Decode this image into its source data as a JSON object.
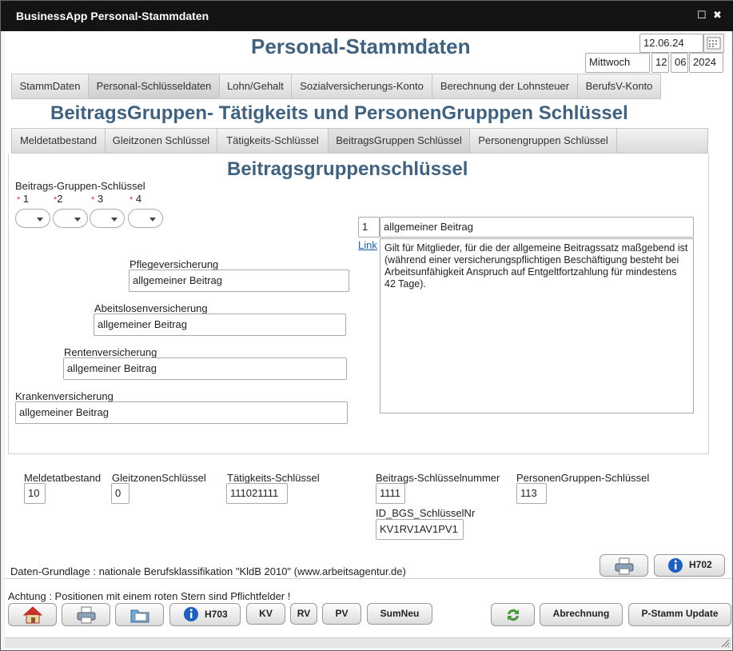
{
  "window": {
    "title": "BusinessApp Personal-Stammdaten",
    "restore_label": "☐",
    "close_label": "✖"
  },
  "header": {
    "title": "Personal-Stammdaten",
    "date": "12.06.24",
    "weekday": "Mittwoch",
    "day": "12",
    "month": "06",
    "year": "2024"
  },
  "main_tabs": [
    "StammDaten",
    "Personal-Schlüsseldaten",
    "Lohn/Gehalt",
    "Sozialversicherungs-Konto",
    "Berechnung der Lohnsteuer",
    "BerufsV-Konto"
  ],
  "section_title": "BeitragsGruppen- Tätigkeits und PersonenGrupppen Schlüssel",
  "sub_tabs": [
    "Meldetatbestand",
    "Gleitzonen Schlüssel",
    "Tätigkeits-Schlüssel",
    "BeitragsGruppen Schlüssel",
    "Personengruppen Schlüssel"
  ],
  "panel": {
    "title": "Beitragsgruppenschlüssel",
    "group_label": "Beitrags-Gruppen-Schlüssel",
    "star": "*",
    "positions": [
      "1",
      "2",
      "3",
      "4"
    ],
    "pflege": {
      "label": "Pflegeversicherung",
      "value": "allgemeiner Beitrag"
    },
    "arbeitslosen": {
      "label": "Abeitslosenversicherung",
      "value": "allgemeiner Beitrag"
    },
    "renten": {
      "label": "Rentenversicherung",
      "value": "allgemeiner Beitrag"
    },
    "kranken": {
      "label": "Krankenversicherung",
      "value": "allgemeiner Beitrag"
    },
    "selected_number": "1",
    "selected_name": "allgemeiner Beitrag",
    "link_label": "Link",
    "description": "Gilt für Mitglieder, für die der allgemeine Beitragssatz maßgebend ist (während einer versicherungspflichtigen Beschäftigung besteht bei Arbeitsunfähigkeit Anspruch auf Entgeltfortzahlung für mindestens 42 Tage)."
  },
  "summary": {
    "meldetatbestand": {
      "label": "Meldetatbestand",
      "value": "10"
    },
    "gleitzonen": {
      "label": "GleitzonenSchlüssel",
      "value": "0"
    },
    "taetigkeit": {
      "label": "Tätigkeits-Schlüssel",
      "value": "111021111"
    },
    "beitrag": {
      "label": "Beitrags-Schlüsselnummer",
      "value": "1111"
    },
    "personen": {
      "label": "PersonenGruppen-Schlüssel",
      "value": "113"
    },
    "id_bgs": {
      "label": "ID_BGS_SchlüsselNr",
      "value": "KV1RV1AV1PV1"
    }
  },
  "footer": {
    "source_note": "Daten-Grundlage : nationale Berufsklassifikation \"KldB 2010\" (www.arbeitsagentur.de)",
    "h702": "H702",
    "hint": "Achtung : Positionen mit einem roten Stern sind Pflichtfelder !",
    "h703": "H703",
    "kv": "KV",
    "rv": "RV",
    "pv": "PV",
    "sumneu": "SumNeu",
    "abrechnung": "Abrechnung",
    "pstamm": "P-Stamm Update"
  },
  "colors": {
    "heading": "#41627e",
    "titlebar": "#141414",
    "star": "#d33333",
    "link": "#1a5fa8"
  }
}
